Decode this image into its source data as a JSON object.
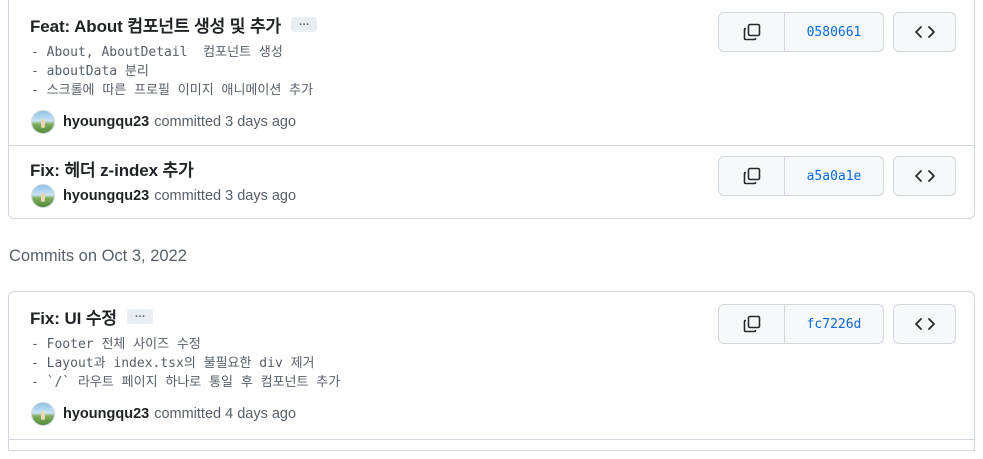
{
  "groups": [
    {
      "header": "",
      "commits": [
        {
          "title": "Feat: About 컴포넌트 생성 및 추가",
          "ellipsis": "…",
          "description": "- About, AboutDetail  컴포넌트 생성\n- aboutData 분리\n- 스크롤에 따른 프로필 이미지 애니메이션 추가",
          "author": "hyoungqu23",
          "committed": "committed 3 days ago",
          "sha": "0580661",
          "copy_icon": "copy-icon",
          "browse_icon": "code-icon"
        },
        {
          "title": "Fix: 헤더 z-index 추가",
          "author": "hyoungqu23",
          "committed": "committed 3 days ago",
          "sha": "a5a0a1e",
          "copy_icon": "copy-icon",
          "browse_icon": "code-icon"
        }
      ]
    },
    {
      "header": "Commits on Oct 3, 2022",
      "commits": [
        {
          "title": "Fix: UI 수정",
          "ellipsis": "…",
          "description": "- Footer 전체 사이즈 수정\n- Layout과 index.tsx의 불필요한 div 제거\n- `/` 라우트 페이지 하나로 통일 후 컴포넌트 추가",
          "author": "hyoungqu23",
          "committed": "committed 4 days ago",
          "sha": "fc7226d",
          "copy_icon": "copy-icon",
          "browse_icon": "code-icon"
        }
      ]
    }
  ],
  "colors": {
    "link": "#0969da",
    "muted": "#57606a",
    "border": "#d0d7de",
    "button_bg": "#f6f8fa"
  }
}
